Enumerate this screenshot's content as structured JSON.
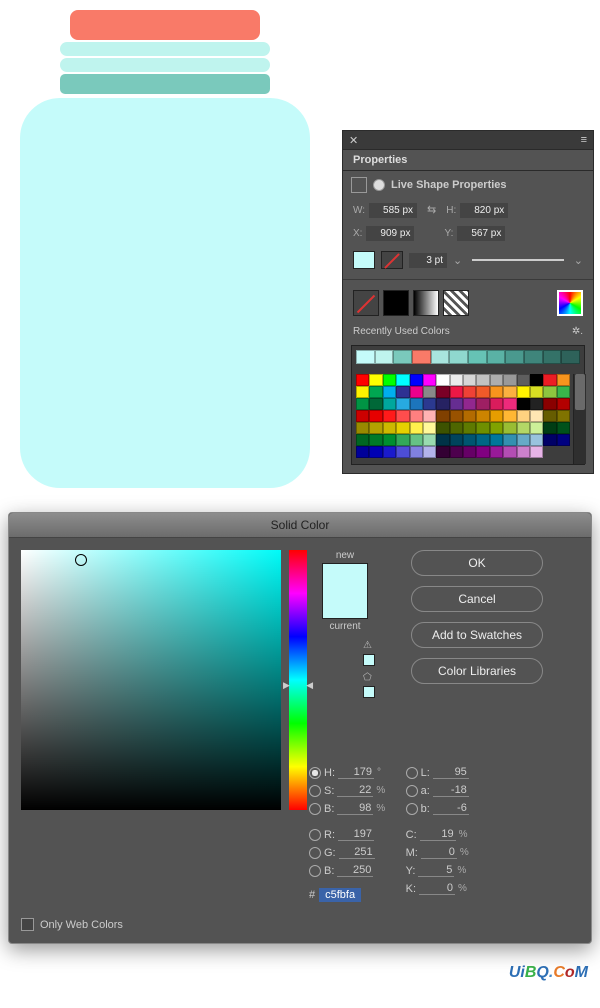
{
  "properties": {
    "panel_title": "Properties",
    "section_title": "Live Shape Properties",
    "w_label": "W:",
    "w_value": "585 px",
    "h_label": "H:",
    "h_value": "820 px",
    "x_label": "X:",
    "x_value": "909 px",
    "y_label": "Y:",
    "y_value": "567 px",
    "stroke_weight": "3 pt",
    "recent_label": "Recently Used Colors",
    "recent_colors": [
      "#c5fbfa",
      "#bff4ee",
      "#7ac9bc",
      "#f97a68",
      "#a9e5de",
      "#8fd8ce",
      "#66c3b5",
      "#5ab2a5",
      "#4a998e",
      "#3f857b",
      "#347268",
      "#2e625a"
    ]
  },
  "dialog": {
    "title": "Solid Color",
    "new_label": "new",
    "current_label": "current",
    "new_color": "#c5fbfa",
    "current_color": "#c5fbfa",
    "buttons": {
      "ok": "OK",
      "cancel": "Cancel",
      "add": "Add to Swatches",
      "lib": "Color Libraries"
    },
    "web_only": "Only Web Colors",
    "hsb": {
      "h_label": "H:",
      "h": "179",
      "h_unit": "°",
      "s_label": "S:",
      "s": "22",
      "s_unit": "%",
      "b_label": "B:",
      "b": "98",
      "b_unit": "%"
    },
    "rgb": {
      "r_label": "R:",
      "r": "197",
      "g_label": "G:",
      "g": "251",
      "b_label": "B:",
      "b": "250"
    },
    "lab": {
      "l_label": "L:",
      "l": "95",
      "a_label": "a:",
      "a": "-18",
      "b_label": "b:",
      "b": "-6"
    },
    "cmyk": {
      "c_label": "C:",
      "c": "19",
      "m_label": "M:",
      "m": "0",
      "y_label": "Y:",
      "y": "5",
      "k_label": "K:",
      "k": "0",
      "unit": "%"
    },
    "hex_label": "#",
    "hex": "c5fbfa"
  },
  "footer": {
    "text": "UiBQ.CoM"
  },
  "chart_data": null,
  "palette_colors": [
    "#ff0000",
    "#ffff00",
    "#00ff00",
    "#00ffff",
    "#0000ff",
    "#ff00ff",
    "#ffffff",
    "#ebebeb",
    "#d6d6d6",
    "#c2c2c2",
    "#adadad",
    "#999999",
    "#5e5e5e",
    "#000000",
    "#ec1c24",
    "#f7941d",
    "#fff200",
    "#00a651",
    "#00aeef",
    "#2e3192",
    "#ec008c",
    "#898989",
    "#7a0026",
    "#ed1846",
    "#ef4136",
    "#f15a29",
    "#f7941d",
    "#fbb040",
    "#fff200",
    "#d7df23",
    "#8dc63f",
    "#39b54a",
    "#009444",
    "#006838",
    "#00a79d",
    "#27aae1",
    "#1c75bc",
    "#2b3990",
    "#262262",
    "#662d91",
    "#92278f",
    "#9e1f63",
    "#da1c5c",
    "#ee2a7b",
    "#010101",
    "#222222",
    "#8a0000",
    "#b30000",
    "#cc0000",
    "#e60000",
    "#ff1a1a",
    "#ff4d4d",
    "#ff8080",
    "#ffb3b3",
    "#804000",
    "#995200",
    "#b36b00",
    "#cc8400",
    "#e69d00",
    "#ffb733",
    "#ffd280",
    "#ffe6b3",
    "#665c00",
    "#807300",
    "#998a00",
    "#b3a200",
    "#ccb900",
    "#e6d000",
    "#fff04d",
    "#fff999",
    "#3d5200",
    "#4e6600",
    "#5e7a00",
    "#6f8f00",
    "#80a300",
    "#99bd33",
    "#b3d766",
    "#ccf099",
    "#003d14",
    "#00521b",
    "#006622",
    "#007a29",
    "#008f30",
    "#33a859",
    "#66c285",
    "#99dbb0",
    "#003347",
    "#00445c",
    "#005570",
    "#006685",
    "#00779a",
    "#3390b0",
    "#66aac7",
    "#99c3de",
    "#000066",
    "#000080",
    "#000099",
    "#0000b3",
    "#1a1acc",
    "#4d4dd6",
    "#8080e0",
    "#b3b3eb",
    "#330033",
    "#4d004d",
    "#660066",
    "#800080",
    "#991a99",
    "#b34db3",
    "#cc80cc",
    "#e6b3e6"
  ]
}
